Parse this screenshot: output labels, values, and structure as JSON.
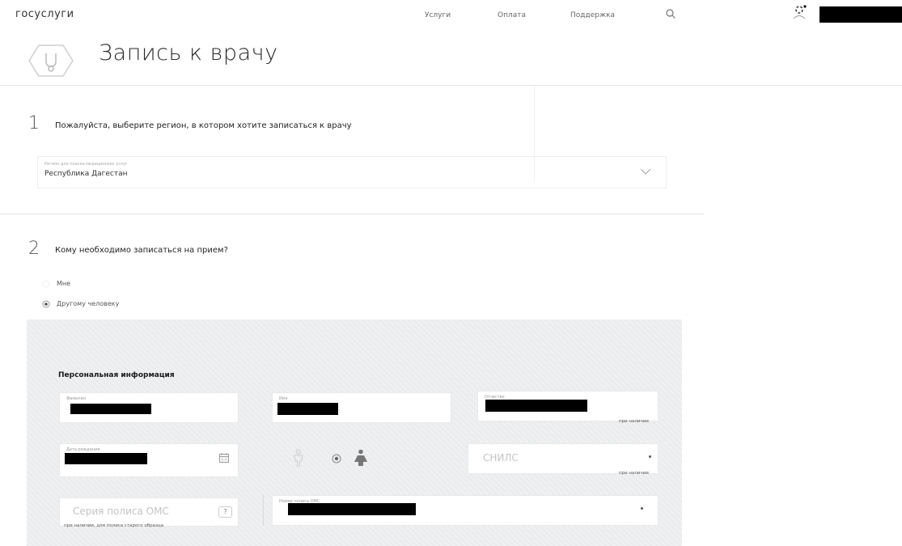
{
  "header": {
    "logo": "госуслуги",
    "nav": [
      "Услуги",
      "Оплата",
      "Поддержка"
    ]
  },
  "page": {
    "title": "Запись к врачу"
  },
  "step1": {
    "number": "1",
    "question": "Пожалуйста, выберите регион, в котором хотите записаться к врачу",
    "region_label": "Регион для поиска медицинских услуг",
    "region_value": "Республика Дагестан"
  },
  "step2": {
    "number": "2",
    "question": "Кому необходимо записаться на прием?",
    "options": [
      "Мне",
      "Другому человеку"
    ]
  },
  "form": {
    "section_title": "Персональная информация",
    "surname_label": "Фамилия",
    "name_label": "Имя",
    "patronymic_label": "Отчество",
    "birthdate_label": "Дата рождения",
    "snils_placeholder": "СНИЛС",
    "oms_series_placeholder": "Серия полиса ОМС",
    "oms_number_label": "Номер полиса ОМС",
    "help_symbol": "?",
    "hint_optional": "при наличии",
    "hint_oms": "при наличии, для полиса старого образца"
  },
  "colors": {
    "panel": "#eef0f2",
    "redaction": "#000000"
  }
}
